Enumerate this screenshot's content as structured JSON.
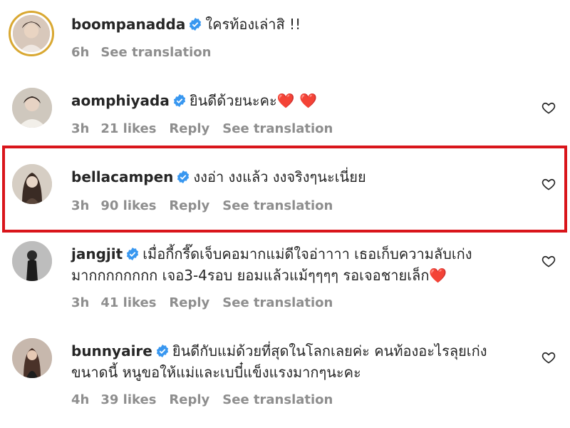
{
  "colors": {
    "text": "#262626",
    "meta": "#8e8e8e",
    "verified": "#3897f0",
    "highlight": "#d9151b",
    "heart_emoji": "#e0262b"
  },
  "comments": [
    {
      "username": "boompanadda",
      "verified": true,
      "text": "ใครท้องเล่าสิ !!",
      "time": "6h",
      "likes": "",
      "reply": "",
      "see_translation": "See translation",
      "has_like_button": false
    },
    {
      "username": "aomphiyada",
      "verified": true,
      "text": "ยินดีด้วยนะคะ",
      "emoji": "❤️ ❤️",
      "time": "3h",
      "likes": "21 likes",
      "reply": "Reply",
      "see_translation": "See translation",
      "has_like_button": true
    },
    {
      "username": "bellacampen",
      "verified": true,
      "text": "งงอ่า งงแล้ว งงจริงๆนะเนี่ยย",
      "time": "3h",
      "likes": "90 likes",
      "reply": "Reply",
      "see_translation": "See translation",
      "has_like_button": true,
      "highlighted": true
    },
    {
      "username": "jangjit",
      "verified": true,
      "text_line1": "เมื่อกี้กรี๊ดเจ็บคอมากแม่ดีใจอ่าาาา เธอเก็บความลับเก่ง",
      "text_line2": "มากกกกกกกก เจอ3-4รอบ ยอมแล้วแม้ๆๆๆๆ รอเจอชายเล็ก",
      "emoji": "❤️",
      "time": "3h",
      "likes": "41 likes",
      "reply": "Reply",
      "see_translation": "See translation",
      "has_like_button": true
    },
    {
      "username": "bunnyaire",
      "verified": true,
      "text_line1": "ยินดีกับแม่ด้วยที่สุดในโลกเลยค่ะ คนท้องอะไรลุยเก่ง",
      "text_line2": "ขนาดนี้ หนูขอให้แม่และเบบี๋แข็งแรงมากๆนะคะ",
      "time": "4h",
      "likes": "39 likes",
      "reply": "Reply",
      "see_translation": "See translation",
      "has_like_button": true
    }
  ]
}
